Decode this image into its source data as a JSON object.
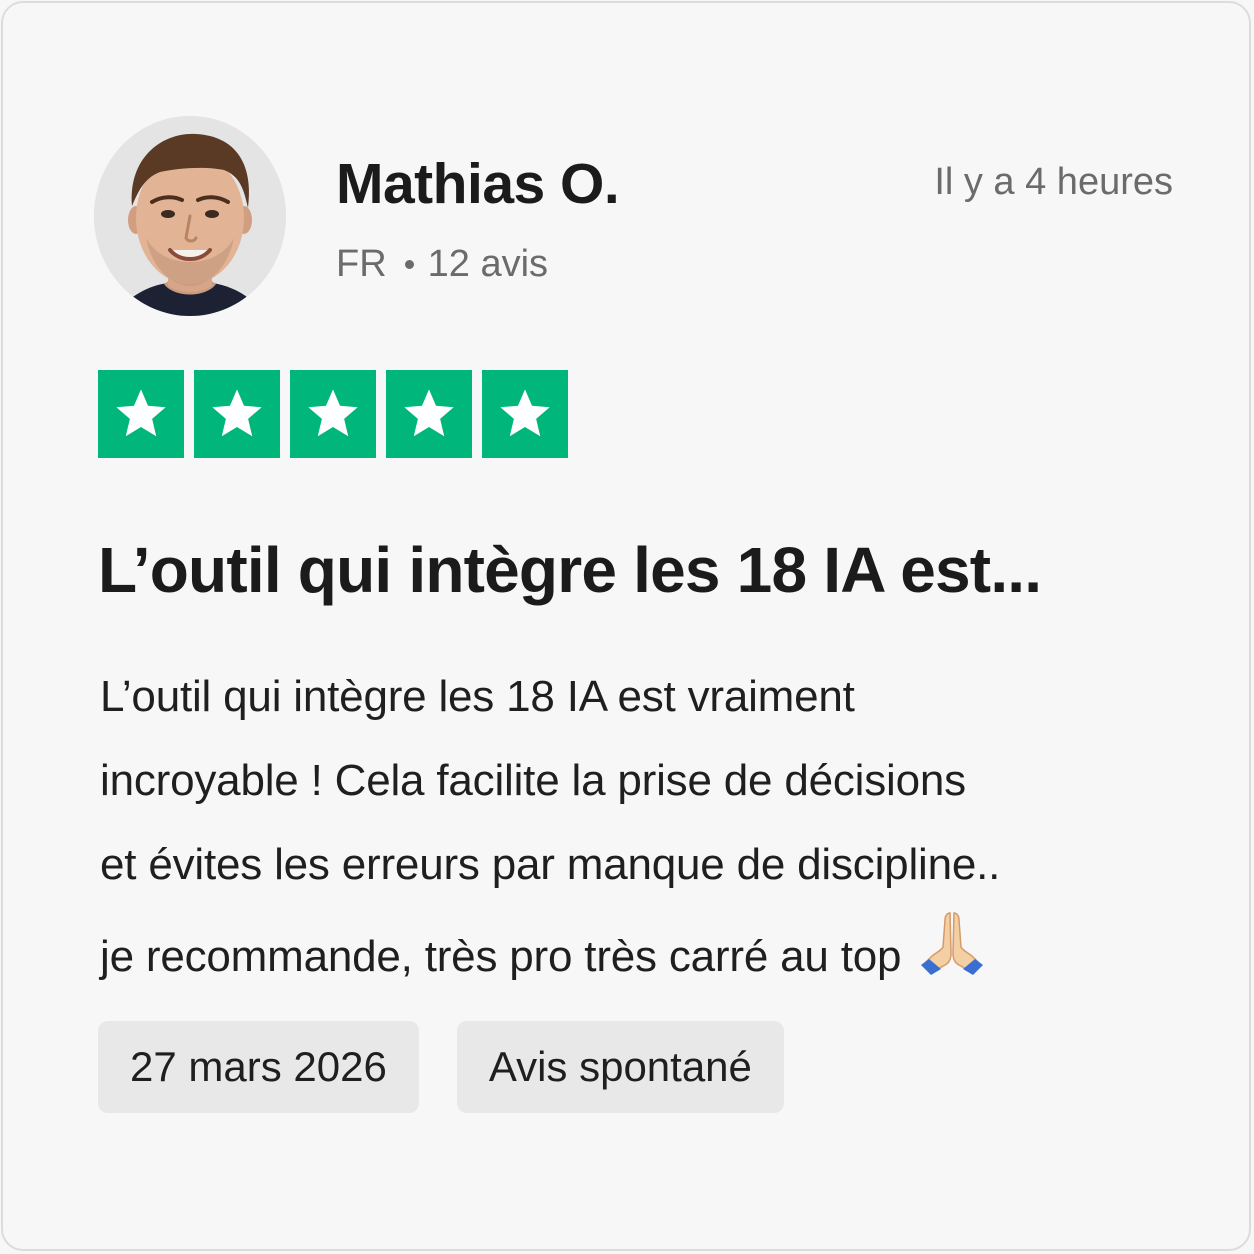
{
  "reviewer": {
    "name": "Mathias O.",
    "country": "FR",
    "review_count": "12 avis",
    "avatar_icon": "reviewer-photo"
  },
  "review": {
    "relative_time": "Il y a 4 heures",
    "rating": 5,
    "rating_max": 5,
    "star_color": "#00b67a",
    "title": "L’outil qui intègre les 18 IA est...",
    "body_lines": [
      "L’outil qui intègre les 18 IA est vraiment",
      "incroyable ! Cela facilite la prise de décisions",
      "et évites les erreurs par manque de discipline..",
      "je recommande, très pro très carré au top"
    ],
    "body_emoji": "praying-hands-icon",
    "date": "27 mars 2026",
    "type": "Avis spontané"
  }
}
